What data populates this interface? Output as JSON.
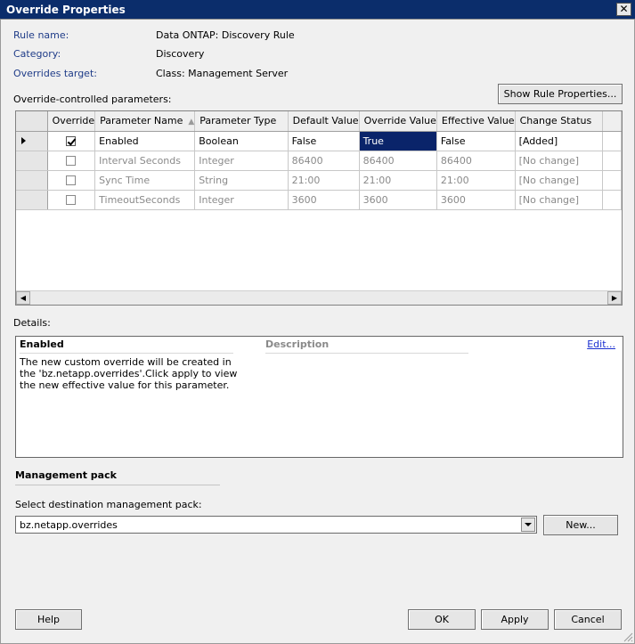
{
  "window": {
    "title": "Override Properties",
    "close_glyph": "✕"
  },
  "meta": [
    {
      "label": "Rule name:",
      "value": "Data ONTAP: Discovery Rule"
    },
    {
      "label": "Category:",
      "value": "Discovery"
    },
    {
      "label": "Overrides target:",
      "value": "Class: Management Server"
    }
  ],
  "params_label": "Override-controlled parameters:",
  "show_rule_button": "Show Rule Properties...",
  "grid": {
    "columns": [
      "Override",
      "Parameter Name",
      "Parameter Type",
      "Default Value",
      "Override Value",
      "Effective Value",
      "Change Status"
    ],
    "sort_indicator": "▲",
    "rows": [
      {
        "override": true,
        "name": "Enabled",
        "type": "Boolean",
        "default": "False",
        "override_value": "True",
        "effective": "False",
        "status": "[Added]"
      },
      {
        "override": false,
        "name": "Interval Seconds",
        "type": "Integer",
        "default": "86400",
        "override_value": "86400",
        "effective": "86400",
        "status": "[No change]"
      },
      {
        "override": false,
        "name": "Sync Time",
        "type": "String",
        "default": "21:00",
        "override_value": "21:00",
        "effective": "21:00",
        "status": "[No change]"
      },
      {
        "override": false,
        "name": "TimeoutSeconds",
        "type": "Integer",
        "default": "3600",
        "override_value": "3600",
        "effective": "3600",
        "status": "[No change]"
      }
    ]
  },
  "details": {
    "label": "Details:",
    "param_name": "Enabled",
    "description_header": "Description",
    "edit_link": "Edit...",
    "text": "The new custom override will be created in the 'bz.netapp.overrides'.Click apply to view  the new effective value for this parameter."
  },
  "management_pack": {
    "header": "Management pack",
    "select_label": "Select destination management pack:",
    "selected": "bz.netapp.overrides",
    "new_button": "New..."
  },
  "buttons": {
    "help": "Help",
    "ok": "OK",
    "apply": "Apply",
    "cancel": "Cancel"
  }
}
